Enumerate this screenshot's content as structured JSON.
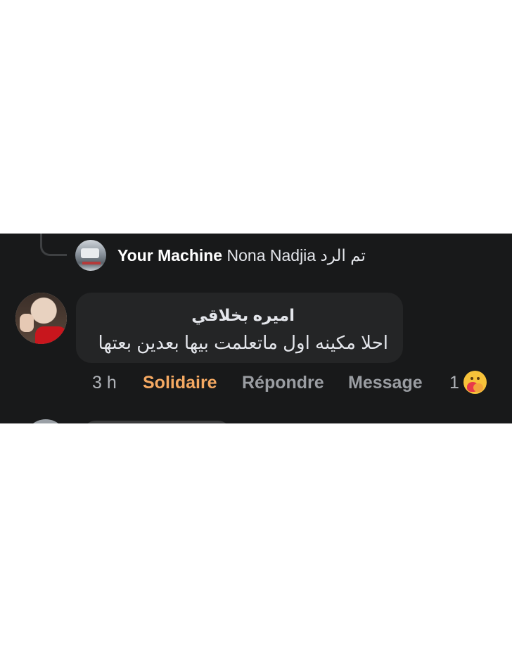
{
  "reply_summary": {
    "page_name": "Your Machine",
    "user_name": "Nona Nadjia",
    "status_text": "تم الرد"
  },
  "comment": {
    "author": "اميره بخلاقي",
    "text": "احلا مكينه اول ماتعلمت بيها بعدين بعتها",
    "time": "3 h",
    "reaction_label": "Solidaire",
    "reply_label": "Répondre",
    "message_label": "Message",
    "reaction_count": "1",
    "reaction_icon": "care-icon"
  },
  "colors": {
    "background": "#18191a",
    "bubble": "#242526",
    "reaction_accent": "#f5a962"
  }
}
